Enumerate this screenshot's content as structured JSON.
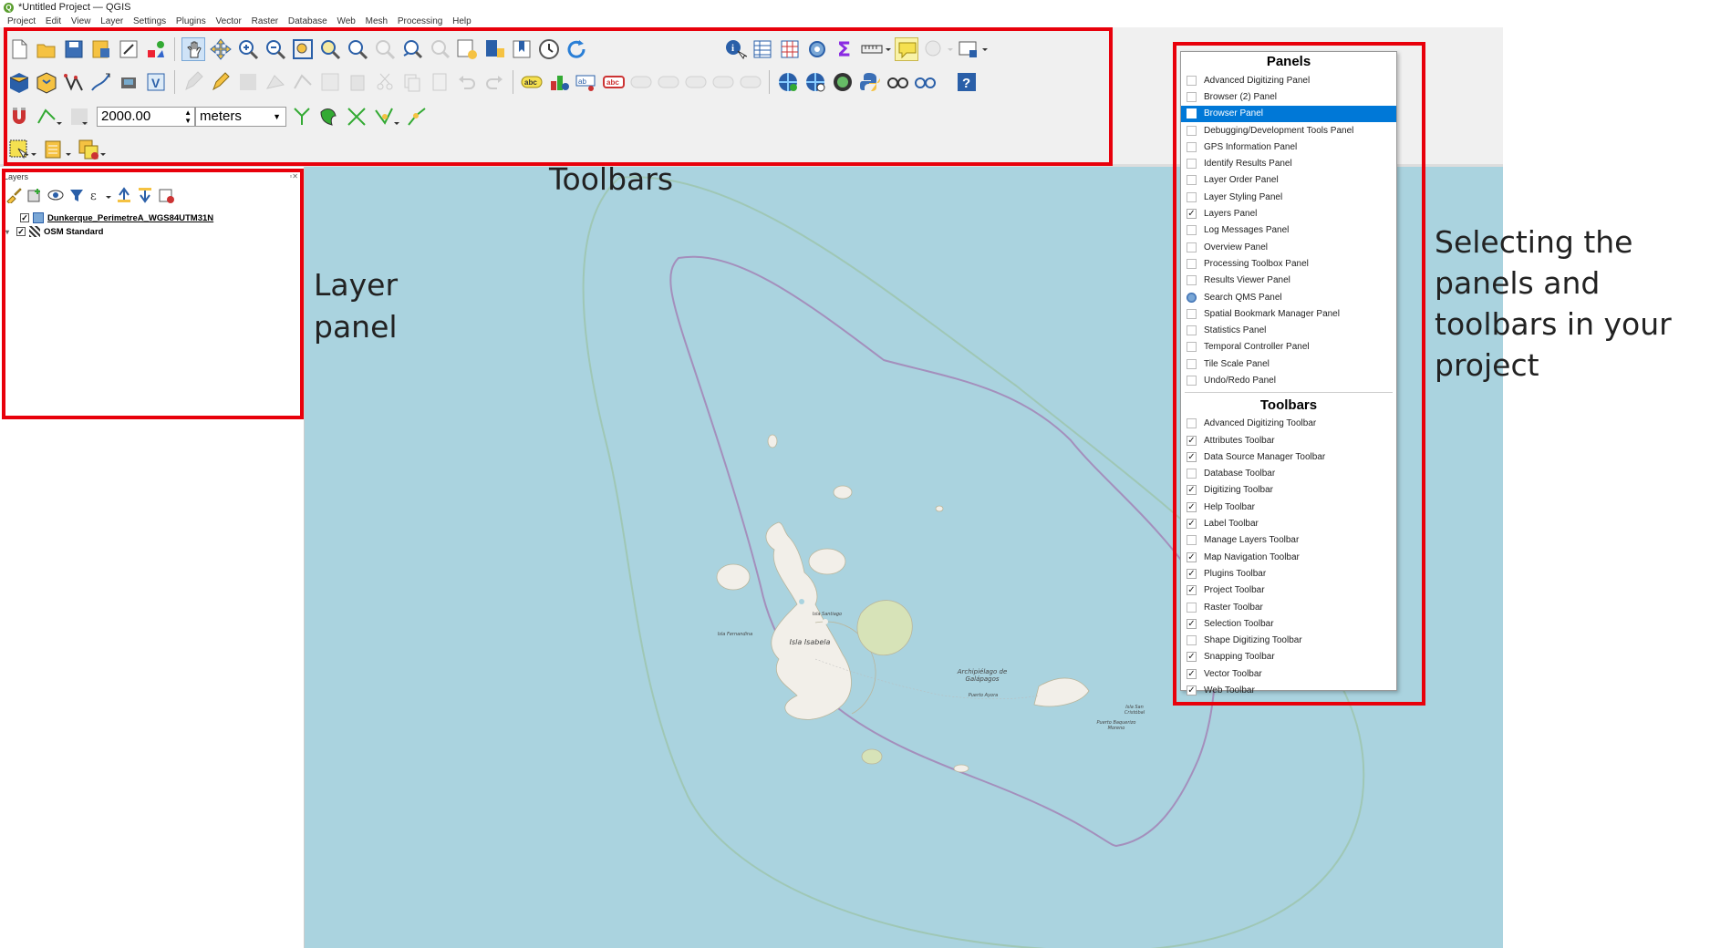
{
  "window": {
    "title": "*Untitled Project — QGIS",
    "app_icon": "qgis-icon"
  },
  "menubar": [
    "Project",
    "Edit",
    "View",
    "Layer",
    "Settings",
    "Plugins",
    "Vector",
    "Raster",
    "Database",
    "Web",
    "Mesh",
    "Processing",
    "Help"
  ],
  "snapping": {
    "tolerance": "2000.00",
    "units": "meters"
  },
  "layers_panel": {
    "title": "Layers",
    "layers": [
      {
        "name": "Dunkerque_PerimetreA_WGS84UTM31N",
        "checked": true
      },
      {
        "name": "OSM Standard",
        "checked": true
      }
    ]
  },
  "popup": {
    "panels_header": "Panels",
    "panels": [
      {
        "label": "Advanced Digitizing Panel",
        "checked": false
      },
      {
        "label": "Browser (2) Panel",
        "checked": false
      },
      {
        "label": "Browser Panel",
        "checked": false,
        "selected": true
      },
      {
        "label": "Debugging/Development Tools Panel",
        "checked": false
      },
      {
        "label": "GPS Information Panel",
        "checked": false
      },
      {
        "label": "Identify Results Panel",
        "checked": false
      },
      {
        "label": "Layer Order Panel",
        "checked": false
      },
      {
        "label": "Layer Styling Panel",
        "checked": false
      },
      {
        "label": "Layers Panel",
        "checked": true
      },
      {
        "label": "Log Messages Panel",
        "checked": false
      },
      {
        "label": "Overview Panel",
        "checked": false
      },
      {
        "label": "Processing Toolbox Panel",
        "checked": false
      },
      {
        "label": "Results Viewer Panel",
        "checked": false
      },
      {
        "label": "Search QMS Panel",
        "checked": false,
        "icon": "qms-globe-icon"
      },
      {
        "label": "Spatial Bookmark Manager Panel",
        "checked": false
      },
      {
        "label": "Statistics Panel",
        "checked": false
      },
      {
        "label": "Temporal Controller Panel",
        "checked": false
      },
      {
        "label": "Tile Scale Panel",
        "checked": false
      },
      {
        "label": "Undo/Redo Panel",
        "checked": false
      }
    ],
    "toolbars_header": "Toolbars",
    "toolbars": [
      {
        "label": "Advanced Digitizing Toolbar",
        "checked": false
      },
      {
        "label": "Attributes Toolbar",
        "checked": true
      },
      {
        "label": "Data Source Manager Toolbar",
        "checked": true
      },
      {
        "label": "Database Toolbar",
        "checked": false
      },
      {
        "label": "Digitizing Toolbar",
        "checked": true
      },
      {
        "label": "Help Toolbar",
        "checked": true
      },
      {
        "label": "Label Toolbar",
        "checked": true
      },
      {
        "label": "Manage Layers Toolbar",
        "checked": false
      },
      {
        "label": "Map Navigation Toolbar",
        "checked": true
      },
      {
        "label": "Plugins Toolbar",
        "checked": true
      },
      {
        "label": "Project Toolbar",
        "checked": true
      },
      {
        "label": "Raster Toolbar",
        "checked": false
      },
      {
        "label": "Selection Toolbar",
        "checked": true
      },
      {
        "label": "Shape Digitizing Toolbar",
        "checked": false
      },
      {
        "label": "Snapping Toolbar",
        "checked": true
      },
      {
        "label": "Vector Toolbar",
        "checked": true
      },
      {
        "label": "Web Toolbar",
        "checked": true
      }
    ]
  },
  "map": {
    "labels": [
      "Isla Isabela",
      "Isla Fernandina",
      "Isla Santiago",
      "Archipiélago de Galápagos",
      "Puerto Ayora",
      "Isla San Cristóbal",
      "Puerto Baquerizo Moreno"
    ]
  },
  "annotations": {
    "toolbars": "Toolbars",
    "layer_panel": "Layer panel",
    "selecting": "Selecting the panels and toolbars in your project"
  },
  "colors": {
    "highlight": "#e8000b",
    "selection": "#0078d7",
    "sea": "#aad3df",
    "land": "#f2efe9"
  }
}
